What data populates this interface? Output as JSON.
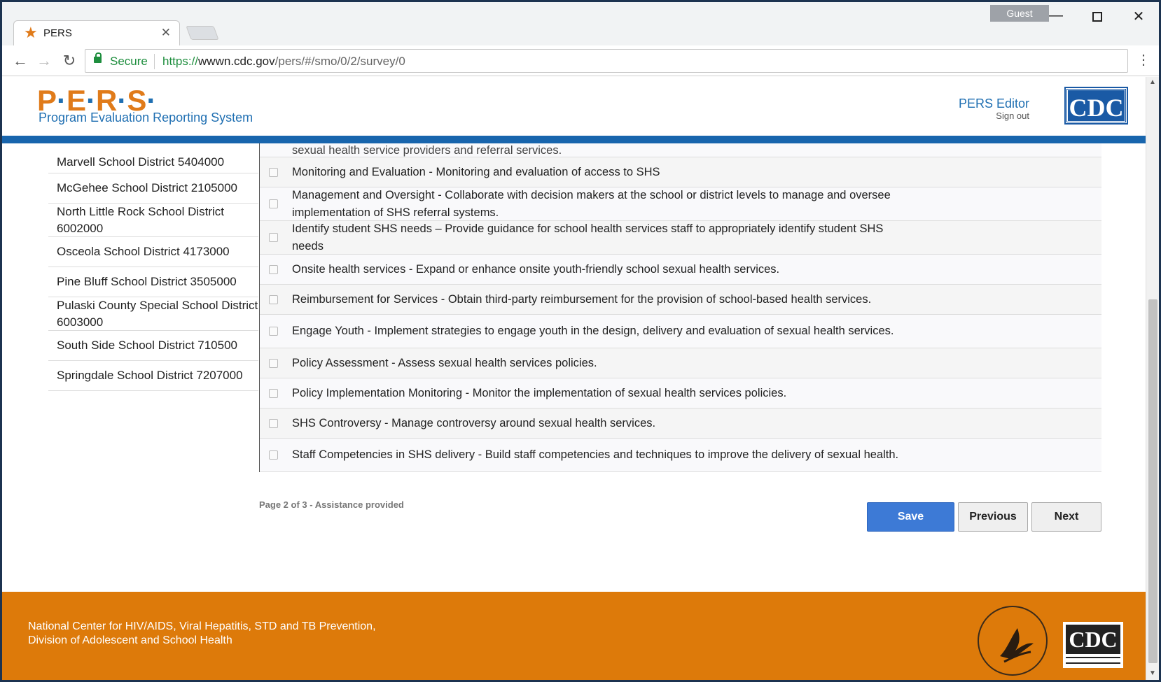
{
  "browser": {
    "tab_title": "PERS",
    "profile_label": "Guest",
    "secure_label": "Secure",
    "url_scheme": "https://",
    "url_host": "wwwn.cdc.gov",
    "url_path": "/pers/#/smo/0/2/survey/0"
  },
  "header": {
    "logo_text": "P·E·R·S·",
    "logo_subtitle": "Program Evaluation Reporting System",
    "user_name": "PERS Editor",
    "sign_out": "Sign out",
    "cdc_label": "CDC"
  },
  "districts": [
    {
      "label": "Marvell School District 5404000"
    },
    {
      "label": "McGehee School District 2105000"
    },
    {
      "label": "North Little Rock School District 6002000"
    },
    {
      "label": "Osceola School District 4173000"
    },
    {
      "label": "Pine Bluff School District 3505000"
    },
    {
      "label": "Pulaski County Special School District 6003000"
    },
    {
      "label": "South Side School District 710500"
    },
    {
      "label": "Springdale School District 7207000"
    }
  ],
  "questions": {
    "partial_top": "sexual health service providers and referral services.",
    "items": [
      {
        "text": "Monitoring and Evaluation - Monitoring and evaluation of access to SHS",
        "checked": false
      },
      {
        "text": "Management and Oversight - Collaborate with decision makers at the school or district levels to manage and oversee implementation of SHS referral systems.",
        "checked": false
      },
      {
        "text": "Identify student SHS needs – Provide guidance for school health services staff to appropriately identify student SHS needs",
        "checked": false
      },
      {
        "text": "Onsite health services - Expand or enhance onsite youth-friendly school sexual health services.",
        "checked": false
      },
      {
        "text": "Reimbursement for Services - Obtain third-party reimbursement for the provision of school-based health services.",
        "checked": false
      },
      {
        "text": "Engage Youth - Implement strategies to engage youth in the design, delivery and evaluation of sexual health services.",
        "checked": false
      },
      {
        "text": "Policy Assessment - Assess sexual health services policies.",
        "checked": false
      },
      {
        "text": "Policy Implementation Monitoring - Monitor the implementation of sexual health services policies.",
        "checked": false
      },
      {
        "text": "SHS Controversy - Manage controversy around sexual health services.",
        "checked": false
      },
      {
        "text": "Staff Competencies in SHS delivery - Build staff competencies and techniques to improve the delivery of sexual health.",
        "checked": false
      }
    ]
  },
  "pager": {
    "page_info": "Page 2 of 3 - Assistance provided",
    "save_label": "Save",
    "previous_label": "Previous",
    "next_label": "Next"
  },
  "footer": {
    "line1": "National Center for HIV/AIDS, Viral Hepatitis, STD and TB Prevention,",
    "line2": "Division of Adolescent and School Health",
    "cdc_label": "CDC"
  },
  "colors": {
    "brand_orange": "#dd7a0a",
    "brand_blue": "#1865ad",
    "save_blue": "#3d7ad6"
  }
}
